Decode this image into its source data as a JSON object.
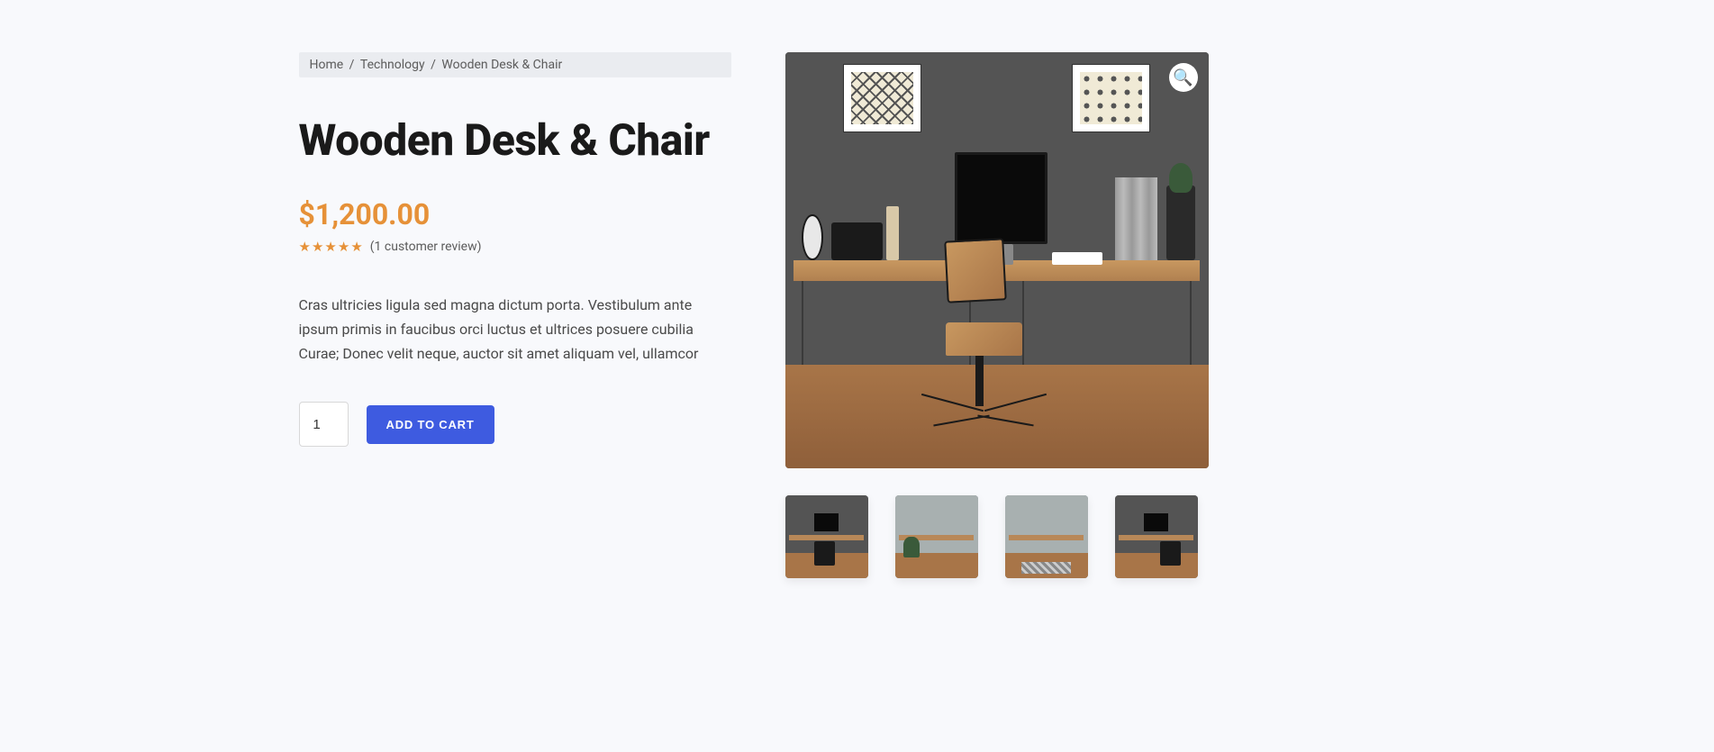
{
  "breadcrumb": {
    "home": "Home",
    "category": "Technology",
    "current": "Wooden Desk & Chair"
  },
  "product": {
    "title": "Wooden Desk & Chair",
    "currency": "$",
    "price": "1,200.00",
    "rating": 5,
    "review_count": "1",
    "review_link_text": "(1 customer review)",
    "description": "Cras ultricies ligula sed magna dictum porta. Vestibulum ante ipsum primis in faucibus orci luctus et ultrices posuere cubilia Curae; Donec velit neque, auctor sit amet aliquam vel, ullamcor",
    "quantity": "1",
    "add_to_cart_label": "ADD TO CART"
  },
  "gallery": {
    "zoom_icon": "🔍",
    "thumbnails_count": 4
  }
}
